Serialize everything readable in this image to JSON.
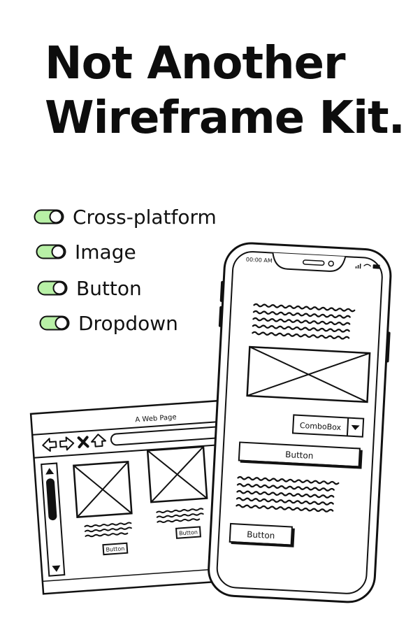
{
  "title": {
    "line1": "Not Another",
    "line2": "Wireframe Kit."
  },
  "features": [
    {
      "label": "Cross-platform",
      "icon": "toggle-on-icon"
    },
    {
      "label": "Image",
      "icon": "toggle-on-icon"
    },
    {
      "label": "Button",
      "icon": "toggle-on-icon"
    },
    {
      "label": "Dropdown",
      "icon": "toggle-on-icon"
    }
  ],
  "colors": {
    "toggle_fill": "#b8f0a6",
    "ink": "#111111"
  },
  "browser": {
    "page_title": "A Web Page",
    "card1_button": "Button",
    "card2_button": "Button"
  },
  "phone": {
    "status_time": "00:00 AM",
    "combobox_value": "ComboBox",
    "wide_button": "Button",
    "small_button": "Button"
  }
}
